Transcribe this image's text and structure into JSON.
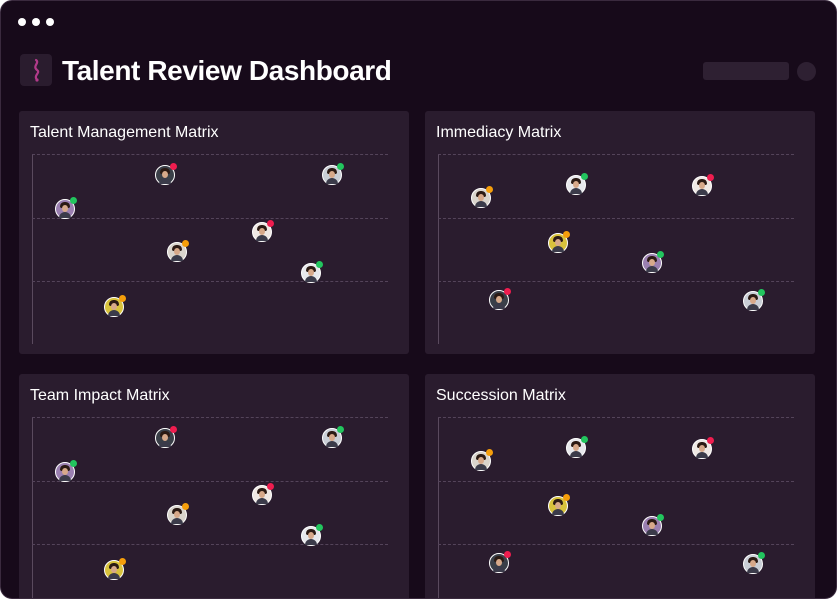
{
  "app": {
    "title": "Talent Review Dashboard",
    "window_controls": [
      "dot",
      "dot",
      "dot"
    ]
  },
  "colors": {
    "background": "#170a1a",
    "panel": "#2a1c2e",
    "status_green": "#22c55e",
    "status_orange": "#f59e0b",
    "status_red": "#ef1d4f"
  },
  "panels": [
    {
      "title": "Talent Management Matrix",
      "people": [
        {
          "bg": "#9a7fb0",
          "status": "green"
        },
        {
          "bg": "#3a3f48",
          "status": "red"
        },
        {
          "bg": "#c9ced6",
          "status": "green"
        },
        {
          "bg": "#d9d4cc",
          "status": "orange"
        },
        {
          "bg": "#efe8e4",
          "status": "red"
        },
        {
          "bg": "#e7e8ec",
          "status": "green"
        },
        {
          "bg": "#d8c23c",
          "status": "orange"
        }
      ]
    },
    {
      "title": "Immediacy Matrix",
      "people": [
        {
          "bg": "#d9d4cc",
          "status": "orange"
        },
        {
          "bg": "#e7e8ec",
          "status": "green"
        },
        {
          "bg": "#efe8e4",
          "status": "red"
        },
        {
          "bg": "#d8c23c",
          "status": "orange"
        },
        {
          "bg": "#9a7fb0",
          "status": "green"
        },
        {
          "bg": "#3a3f48",
          "status": "red"
        },
        {
          "bg": "#c9ced6",
          "status": "green"
        }
      ]
    },
    {
      "title": "Team Impact Matrix",
      "people": [
        {
          "bg": "#9a7fb0",
          "status": "green"
        },
        {
          "bg": "#3a3f48",
          "status": "red"
        },
        {
          "bg": "#c9ced6",
          "status": "green"
        },
        {
          "bg": "#d9d4cc",
          "status": "orange"
        },
        {
          "bg": "#efe8e4",
          "status": "red"
        },
        {
          "bg": "#e7e8ec",
          "status": "green"
        },
        {
          "bg": "#d8c23c",
          "status": "orange"
        }
      ]
    },
    {
      "title": "Succession Matrix",
      "people": [
        {
          "bg": "#d9d4cc",
          "status": "orange"
        },
        {
          "bg": "#e7e8ec",
          "status": "green"
        },
        {
          "bg": "#efe8e4",
          "status": "red"
        },
        {
          "bg": "#d8c23c",
          "status": "orange"
        },
        {
          "bg": "#9a7fb0",
          "status": "green"
        },
        {
          "bg": "#3a3f48",
          "status": "red"
        },
        {
          "bg": "#c9ced6",
          "status": "green"
        }
      ]
    }
  ]
}
